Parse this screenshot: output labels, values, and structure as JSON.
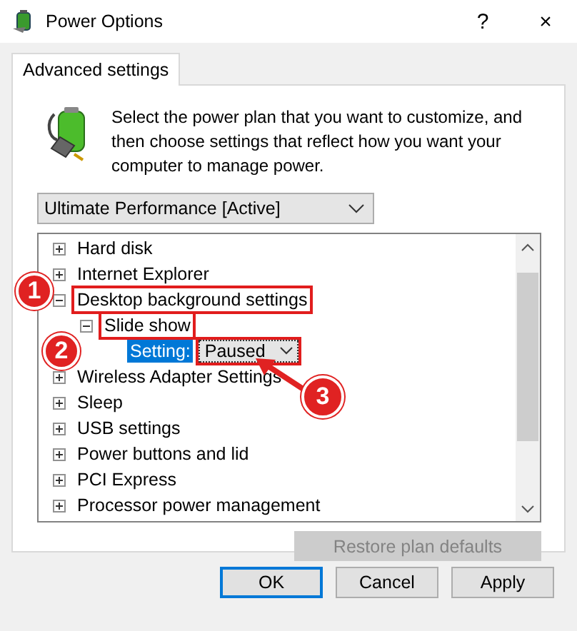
{
  "window": {
    "title": "Power Options",
    "help": "?",
    "close": "×"
  },
  "tabs": [
    {
      "label": "Advanced settings",
      "selected": true
    }
  ],
  "intro": "Select the power plan that you want to customize, and then choose settings that reflect how you want your computer to manage power.",
  "plan": {
    "value": "Ultimate Performance [Active]"
  },
  "tree": [
    {
      "kind": "group",
      "label": "Hard disk",
      "expanded": false,
      "highlighted": false
    },
    {
      "kind": "group",
      "label": "Internet Explorer",
      "expanded": false,
      "highlighted": false
    },
    {
      "kind": "group",
      "label": "Desktop background settings",
      "expanded": true,
      "highlighted": true,
      "marker": "1",
      "children": [
        {
          "kind": "group",
          "label": "Slide show",
          "expanded": true,
          "highlighted": true,
          "marker": "2",
          "children": [
            {
              "kind": "setting",
              "label": "Setting:",
              "selected": true,
              "value": "Paused",
              "highlighted": true,
              "marker": "3"
            }
          ]
        }
      ]
    },
    {
      "kind": "group",
      "label": "Wireless Adapter Settings",
      "expanded": false,
      "highlighted": false
    },
    {
      "kind": "group",
      "label": "Sleep",
      "expanded": false,
      "highlighted": false
    },
    {
      "kind": "group",
      "label": "USB settings",
      "expanded": false,
      "highlighted": false
    },
    {
      "kind": "group",
      "label": "Power buttons and lid",
      "expanded": false,
      "highlighted": false
    },
    {
      "kind": "group",
      "label": "PCI Express",
      "expanded": false,
      "highlighted": false
    },
    {
      "kind": "group",
      "label": "Processor power management",
      "expanded": false,
      "highlighted": false
    }
  ],
  "restore": {
    "label": "Restore plan defaults",
    "disabled": true
  },
  "buttons": [
    {
      "label": "OK",
      "default": true
    },
    {
      "label": "Cancel",
      "default": false
    },
    {
      "label": "Apply",
      "default": false
    }
  ]
}
